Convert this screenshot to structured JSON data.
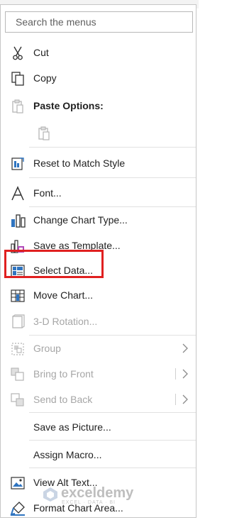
{
  "search": {
    "placeholder": "Search the menus"
  },
  "menu": {
    "items": [
      {
        "label": "Cut"
      },
      {
        "label": "Copy"
      },
      {
        "label": "Paste Options:"
      },
      {
        "label": "Reset to Match Style"
      },
      {
        "label": "Font..."
      },
      {
        "label": "Change Chart Type..."
      },
      {
        "label": "Save as Template..."
      },
      {
        "label": "Select Data..."
      },
      {
        "label": "Move Chart..."
      },
      {
        "label": "3-D Rotation..."
      },
      {
        "label": "Group"
      },
      {
        "label": "Bring to Front"
      },
      {
        "label": "Send to Back"
      },
      {
        "label": "Save as Picture..."
      },
      {
        "label": "Assign Macro..."
      },
      {
        "label": "View Alt Text..."
      },
      {
        "label": "Format Chart Area..."
      }
    ]
  },
  "highlight_color": "#e02020",
  "watermark": {
    "name": "exceldemy",
    "tagline": "EXCEL · DATA · BI"
  }
}
